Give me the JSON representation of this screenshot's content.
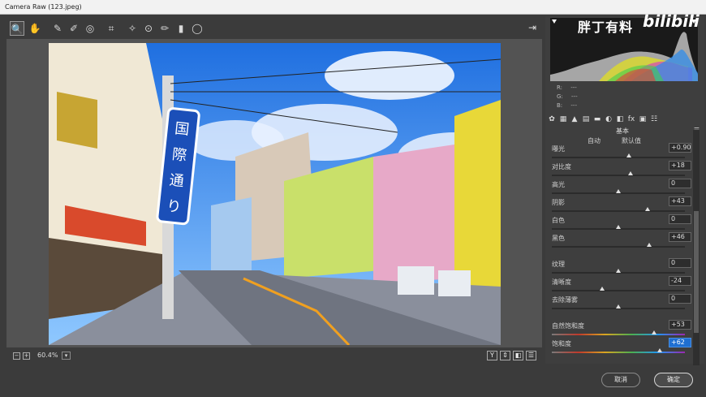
{
  "window": {
    "title": "Camera Raw (123.jpeg)"
  },
  "toolbar": {
    "tools": [
      {
        "name": "zoom-tool-icon",
        "glyph": "🔍"
      },
      {
        "name": "hand-tool-icon",
        "glyph": "✋"
      },
      {
        "name": "white-balance-tool-icon",
        "glyph": "✎"
      },
      {
        "name": "color-sampler-tool-icon",
        "glyph": "✐"
      },
      {
        "name": "targeted-adjustment-tool-icon",
        "glyph": "◎"
      },
      {
        "name": "crop-tool-icon",
        "glyph": "⌗"
      },
      {
        "name": "spot-removal-tool-icon",
        "glyph": "✧"
      },
      {
        "name": "red-eye-tool-icon",
        "glyph": "⊙"
      },
      {
        "name": "adjustment-brush-icon",
        "glyph": "✏"
      },
      {
        "name": "graduated-filter-icon",
        "glyph": "▮"
      },
      {
        "name": "radial-filter-icon",
        "glyph": "◯"
      }
    ]
  },
  "photo": {
    "sign_text": "国際通り"
  },
  "bottom": {
    "zoom_minus": "−",
    "zoom_plus": "+",
    "zoom_level": "60.4%",
    "view_buttons": [
      "Y",
      "⇕",
      "◧",
      "☰"
    ]
  },
  "watermark": {
    "text": "胖丁有料",
    "logo": "bilibili"
  },
  "rgb_readout": {
    "r": "R:",
    "g": "G:",
    "b": "B:",
    "r_val": "---",
    "g_val": "---",
    "b_val": "---"
  },
  "panel": {
    "section_title": "基本",
    "auto_label": "自动",
    "default_label": "默认值",
    "tabs": [
      "✿",
      "▦",
      "▲",
      "▤",
      "▬",
      "◐",
      "◧",
      "fx",
      "▣",
      "☷"
    ]
  },
  "sliders": [
    {
      "label": "曝光",
      "value": "+0.90",
      "pos": 0.58,
      "gap": 0
    },
    {
      "label": "对比度",
      "value": "+18",
      "pos": 0.59,
      "gap": 0
    },
    {
      "label": "高光",
      "value": "0",
      "pos": 0.5,
      "gap": 0
    },
    {
      "label": "阴影",
      "value": "+43",
      "pos": 0.72,
      "gap": 0
    },
    {
      "label": "白色",
      "value": "0",
      "pos": 0.5,
      "gap": 0
    },
    {
      "label": "黑色",
      "value": "+46",
      "pos": 0.73,
      "gap": 0
    },
    {
      "label": "纹理",
      "value": "0",
      "pos": 0.5,
      "gap": 10
    },
    {
      "label": "清晰度",
      "value": "-24",
      "pos": 0.38,
      "gap": 0
    },
    {
      "label": "去除薄雾",
      "value": "0",
      "pos": 0.5,
      "gap": 0
    },
    {
      "label": "自然饱和度",
      "value": "+53",
      "pos": 0.77,
      "gap": 10,
      "grad": true
    },
    {
      "label": "饱和度",
      "value": "+62",
      "pos": 0.81,
      "gap": 0,
      "grad": true,
      "selected": true
    }
  ],
  "buttons": {
    "cancel": "取消",
    "ok": "确定"
  }
}
